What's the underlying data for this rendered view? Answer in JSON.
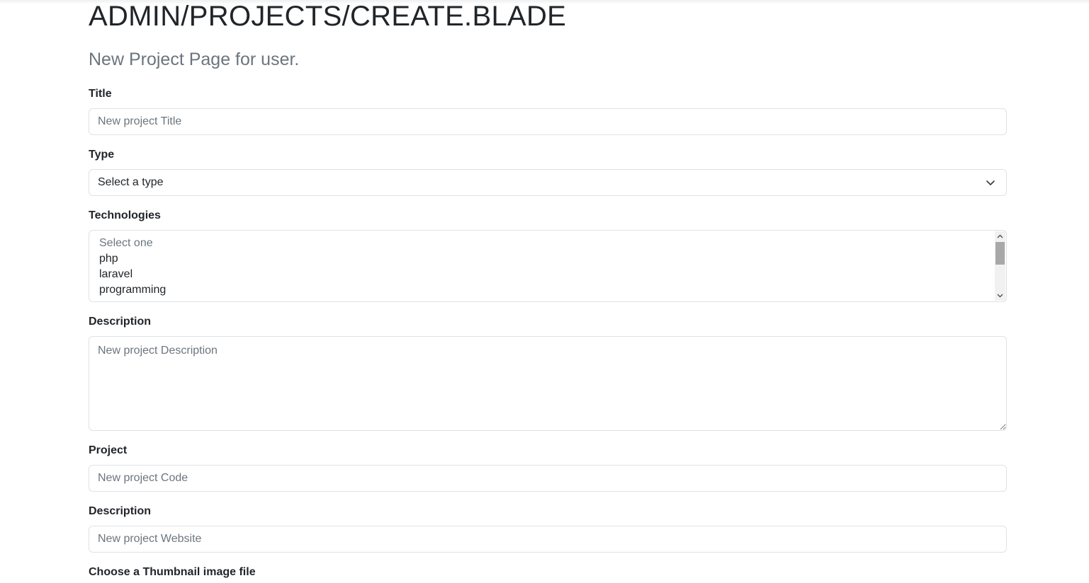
{
  "page": {
    "title": "ADMIN/PROJECTS/CREATE.BLADE",
    "subtitle": "New Project Page for user."
  },
  "form": {
    "title_label": "Title",
    "title_placeholder": "New project Title",
    "type_label": "Type",
    "type_selected": "Select a type",
    "technologies_label": "Technologies",
    "technologies_options": [
      "Select one",
      "php",
      "laravel",
      "programming"
    ],
    "description_label": "Description",
    "description_placeholder": "New project Description",
    "project_label": "Project",
    "project_placeholder": "New project Code",
    "website_label": "Description",
    "website_placeholder": "New project Website",
    "thumbnail_label": "Choose a Thumbnail image file"
  },
  "icons": {
    "select_arrow": "chevron-down-icon",
    "scroll_up": "scroll-up-arrow-icon",
    "scroll_down": "scroll-down-arrow-icon"
  },
  "colors": {
    "text": "#212529",
    "muted": "#6c757d",
    "border": "#dee2e6"
  }
}
